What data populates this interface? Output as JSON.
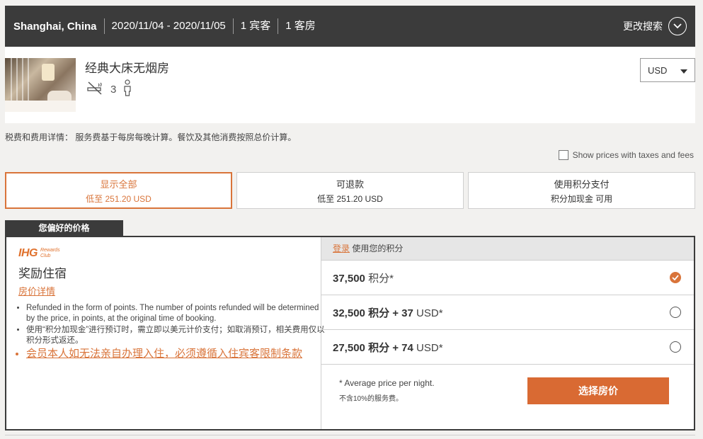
{
  "search": {
    "city": "Shanghai, China",
    "dates": "2020/11/04 - 2020/11/05",
    "guests": "1 宾客",
    "rooms": "1 客房",
    "change_label": "更改搜索"
  },
  "room": {
    "name": "经典大床无烟房",
    "occupancy": "3",
    "currency": "USD"
  },
  "tax_note": "税费和费用详情： 服务费基于每房每晚计算。餐饮及其他消费按照总价计算。",
  "show_taxes_label": "Show prices with taxes and fees",
  "filters": [
    {
      "label": "显示全部",
      "sub": "低至 251.20 USD"
    },
    {
      "label": "可退款",
      "sub": "低至 251.20 USD"
    },
    {
      "label": "使用积分支付",
      "sub": "积分加现金 可用"
    }
  ],
  "preferred_tab": "您偏好的价格",
  "rate": {
    "logo_text": "IHG",
    "logo_sub1": "Rewards",
    "logo_sub2": "Club",
    "title": "奖励住宿",
    "details_link": "房价详情",
    "bullets": [
      "Refunded in the form of points. The number of points refunded will be determined by the price, in points, at the original time of booking.",
      "使用“积分加现金”进行预订时，需立即以美元计价支付；如取消预订，相关费用仅以积分形式返还。",
      "会员本人如无法亲自办理入住，必须遵循入住宾客限制条款"
    ]
  },
  "points": {
    "login_link": "登录",
    "login_text": "使用您的积分",
    "options": [
      {
        "main": "37,500",
        "unit": "积分*",
        "cash": "",
        "cash_unit": ""
      },
      {
        "main": "32,500",
        "unit": "积分 +",
        "cash": "37",
        "cash_unit": "USD*"
      },
      {
        "main": "27,500",
        "unit": "积分 +",
        "cash": "74",
        "cash_unit": "USD*"
      }
    ],
    "selected_index": 0,
    "footnote": "*  Average price per night.",
    "footnote2": "不含10%的服务费。",
    "select_label": "选择房价"
  },
  "colors": {
    "accent": "#d9743a",
    "dark": "#3b3b3b"
  },
  "icons": {
    "smoking": "no-smoking-icon",
    "person": "person-icon",
    "chevron": "chevron-down-icon",
    "check": "check-icon"
  }
}
